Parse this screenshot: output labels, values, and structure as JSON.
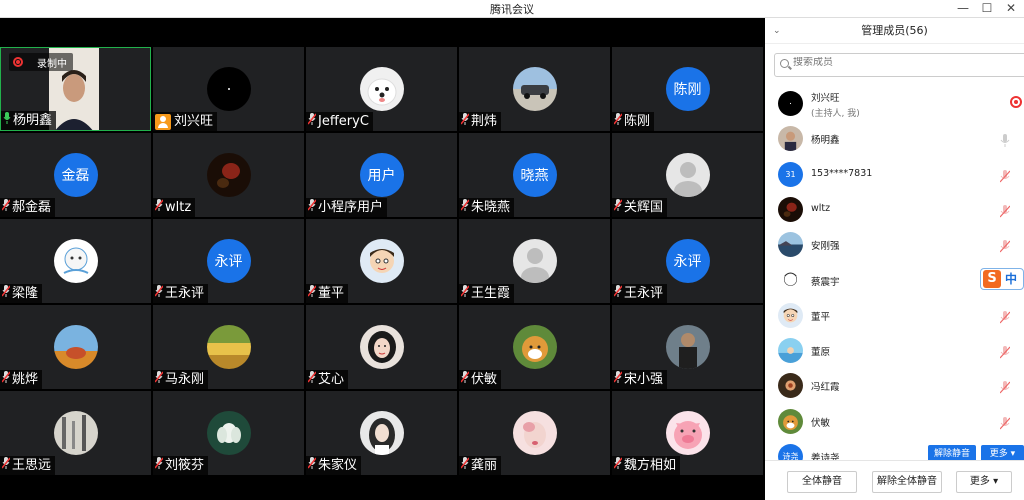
{
  "window": {
    "title": "腾讯会议",
    "min": "—",
    "max": "☐",
    "close": "✕"
  },
  "recording": {
    "label": "录制中"
  },
  "tiles": [
    {
      "name": "杨明鑫",
      "type": "video",
      "active": true
    },
    {
      "name": "刘兴旺",
      "type": "dark",
      "host": true
    },
    {
      "name": "JefferyC",
      "type": "dog"
    },
    {
      "name": "荆炜",
      "type": "car"
    },
    {
      "name": "陈刚",
      "type": "text",
      "avatar_text": "陈刚"
    },
    {
      "name": "郝金磊",
      "type": "text",
      "avatar_text": "金磊"
    },
    {
      "name": "wltz",
      "type": "darkred"
    },
    {
      "name": "小程序用户",
      "type": "text",
      "avatar_text": "用户"
    },
    {
      "name": "朱晓燕",
      "type": "text",
      "avatar_text": "晓燕"
    },
    {
      "name": "关辉国",
      "type": "default"
    },
    {
      "name": "梁隆",
      "type": "cartoon"
    },
    {
      "name": "王永评",
      "type": "text",
      "avatar_text": "永评"
    },
    {
      "name": "董平",
      "type": "boy"
    },
    {
      "name": "王生霞",
      "type": "default"
    },
    {
      "name": "王永评",
      "type": "text",
      "avatar_text": "永评"
    },
    {
      "name": "姚烨",
      "type": "sky"
    },
    {
      "name": "马永刚",
      "type": "field"
    },
    {
      "name": "艾心",
      "type": "girl"
    },
    {
      "name": "伏敏",
      "type": "shiba"
    },
    {
      "name": "宋小强",
      "type": "man"
    },
    {
      "name": "王思远",
      "type": "ink"
    },
    {
      "name": "刘筱芬",
      "type": "lotus"
    },
    {
      "name": "朱家仪",
      "type": "lady"
    },
    {
      "name": "龚丽",
      "type": "pink"
    },
    {
      "name": "魏方相如",
      "type": "pig"
    }
  ],
  "panel": {
    "title": "管理成员(56)",
    "search_placeholder": "搜索成员",
    "members": [
      {
        "name": "刘兴旺",
        "sub": "(主持人, 我)",
        "type": "dark",
        "status": "rec"
      },
      {
        "name": "杨明鑫",
        "type": "video",
        "status": "mic"
      },
      {
        "name": "153****7831",
        "type": "text",
        "avatar_text": "31",
        "status": "muted"
      },
      {
        "name": "wltz",
        "type": "darkred",
        "status": "muted"
      },
      {
        "name": "安刚强",
        "type": "sea",
        "status": "muted"
      },
      {
        "name": "蔡震宇",
        "type": "sketch",
        "status": "sogou"
      },
      {
        "name": "董平",
        "type": "boy",
        "status": "muted"
      },
      {
        "name": "董原",
        "type": "beach",
        "status": "muted"
      },
      {
        "name": "冯红霞",
        "type": "flower",
        "status": "muted"
      },
      {
        "name": "伏敏",
        "type": "shiba",
        "status": "muted"
      },
      {
        "name": "姜诗尧",
        "type": "text",
        "avatar_text": "诗尧",
        "status": "buttons"
      }
    ],
    "row_actions": {
      "mute": "解除静音",
      "more": "更多 ▾"
    },
    "sogou_char": "中",
    "footer": {
      "mute_all": "全体静音",
      "unmute_all": "解除全体静音",
      "more": "更多 ▾"
    }
  }
}
